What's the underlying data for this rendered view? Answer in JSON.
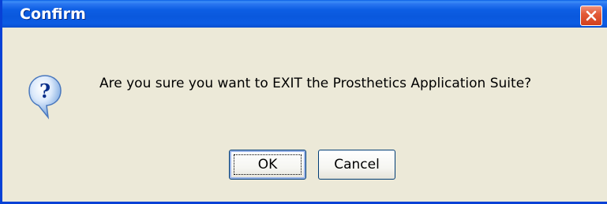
{
  "window": {
    "title": "Confirm"
  },
  "dialog": {
    "icon": "question-icon",
    "message": "Are you sure you want to EXIT the Prosthetics Application Suite?"
  },
  "buttons": {
    "ok_label": "OK",
    "cancel_label": "Cancel"
  },
  "colors": {
    "titlebar": "#0a58dd",
    "window_body": "#ece9d8",
    "close_button": "#d2401d",
    "button_border": "#003c74"
  }
}
